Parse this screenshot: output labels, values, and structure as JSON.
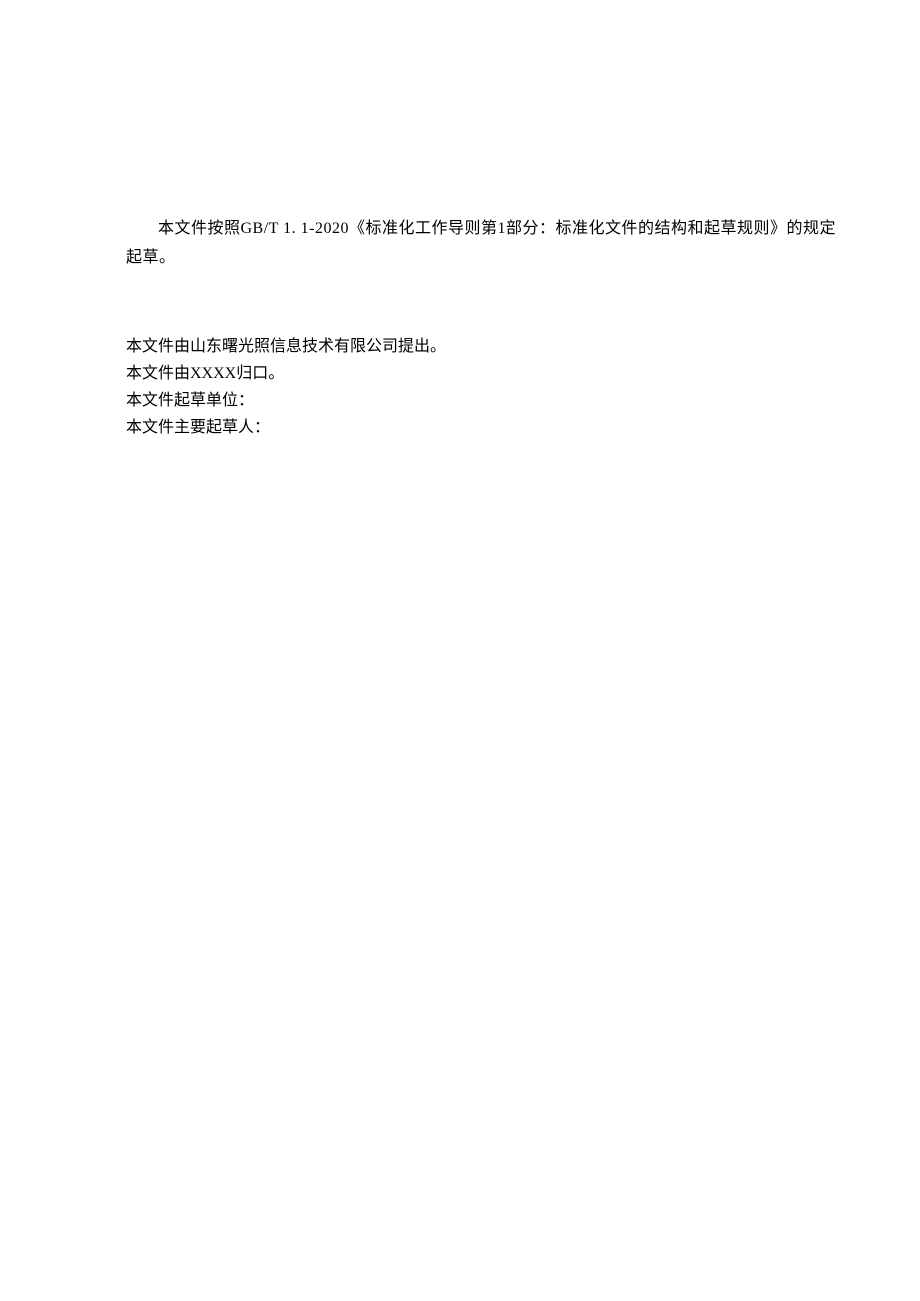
{
  "document": {
    "paragraph1": "本文件按照GB/T 1. 1-2020《标准化工作导则第1部分：标准化文件的结构和起草规则》的规定  起草。",
    "lines": [
      "本文件由山东曙光照信息技术有限公司提出。",
      "本文件由XXXX归口。",
      "本文件起草单位：",
      "本文件主要起草人："
    ]
  }
}
